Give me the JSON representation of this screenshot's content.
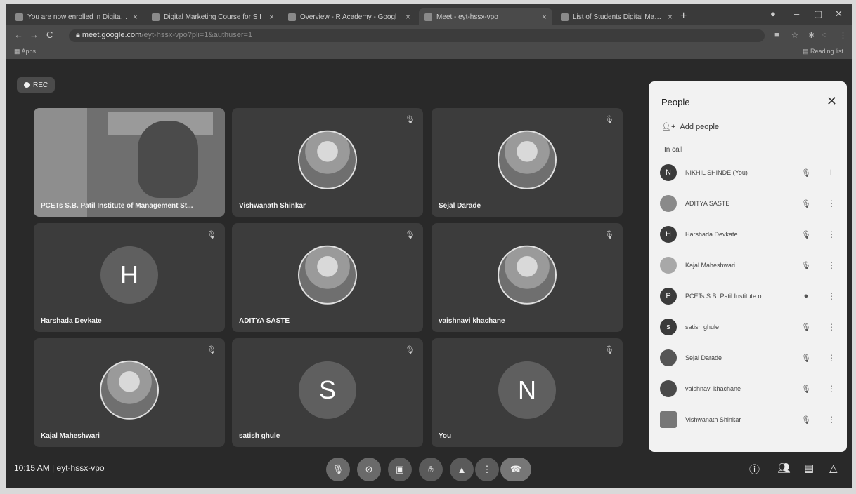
{
  "browser": {
    "tabs": [
      {
        "label": "You are now enrolled in Digital S",
        "close": "×"
      },
      {
        "label": "Digital Marketing Course for S I",
        "close": "×"
      },
      {
        "label": "Overview - R Academy - Googl",
        "close": "×"
      },
      {
        "label": "Meet - eyt-hssx-vpo",
        "close": "×"
      },
      {
        "label": "List of Students Digital Marketin",
        "close": "×"
      }
    ],
    "new_tab": "+",
    "url_host": "meet.google.com",
    "url_path": "/eyt-hssx-vpo?pli=1&authuser=1",
    "apps_label": "Apps",
    "reading_list": "Reading list"
  },
  "meet": {
    "rec_label": "REC",
    "meeting_time": "10:15 AM",
    "separator": "|",
    "meeting_code": "eyt-hssx-vpo",
    "tiles": [
      {
        "name": "PCETs S.B. Patil Institute of Management St..."
      },
      {
        "name": "Vishwanath Shinkar"
      },
      {
        "name": "Sejal Darade"
      },
      {
        "name": "Harshada Devkate",
        "letter": "H"
      },
      {
        "name": "ADITYA SASTE"
      },
      {
        "name": "vaishnavi khachane"
      },
      {
        "name": "Kajal Maheshwari"
      },
      {
        "name": "satish ghule",
        "letter": "S"
      },
      {
        "name": "You",
        "letter": "N"
      }
    ]
  },
  "people_panel": {
    "title": "People",
    "add_people": "Add people",
    "in_call": "In call",
    "participants": [
      {
        "name": "NIKHIL SHINDE (You)",
        "initial": "N"
      },
      {
        "name": "ADITYA SASTE",
        "initial": ""
      },
      {
        "name": "Harshada Devkate",
        "initial": "H"
      },
      {
        "name": "Kajal Maheshwari",
        "initial": ""
      },
      {
        "name": "PCETs S.B. Patil Institute o...",
        "initial": "P"
      },
      {
        "name": "satish ghule",
        "initial": "s"
      },
      {
        "name": "Sejal Darade",
        "initial": ""
      },
      {
        "name": "vaishnavi khachane",
        "initial": ""
      },
      {
        "name": "Vishwanath Shinkar",
        "initial": ""
      }
    ]
  },
  "icons": {
    "mic_off": "mic-off-icon",
    "more": "more-vert-icon",
    "pin": "pin-icon",
    "close": "close-icon"
  }
}
